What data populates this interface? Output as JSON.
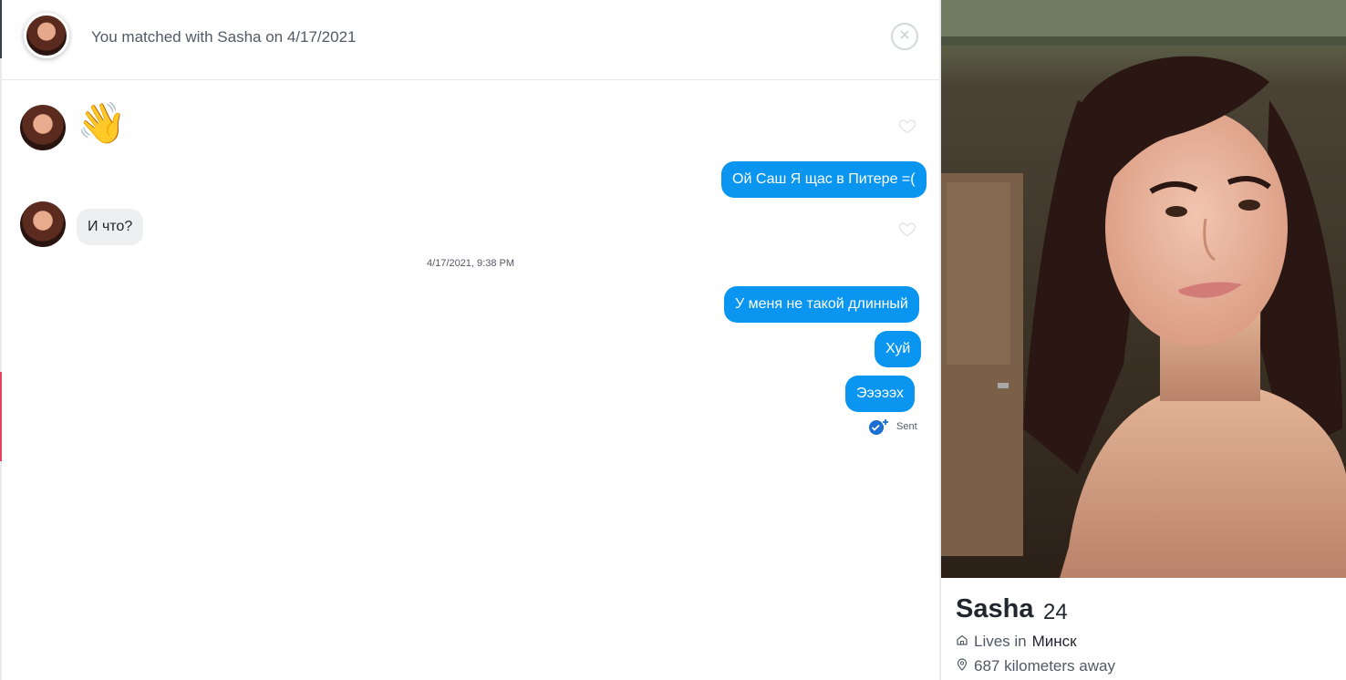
{
  "header": {
    "match_text": "You matched with Sasha on 4/17/2021",
    "close_icon": "close-icon"
  },
  "messages": [
    {
      "direction": "in",
      "text": "👋",
      "type": "emoji"
    },
    {
      "direction": "out",
      "text": "Ой Саш Я щас в Питере =("
    },
    {
      "direction": "in",
      "text": "И что?"
    },
    {
      "direction": "out",
      "text": "У меня не такой длинный"
    },
    {
      "direction": "out",
      "text": "Хуй"
    },
    {
      "direction": "out",
      "text": "Эээээх"
    }
  ],
  "timestamp": "4/17/2021, 9:38 PM",
  "status": {
    "label": "Sent",
    "icon": "sent-check-icon"
  },
  "profile": {
    "name": "Sasha",
    "age": "24",
    "lives_prefix": "Lives in",
    "city": "Минск",
    "distance": "687 kilometers away"
  },
  "colors": {
    "outgoing_bubble": "#0a96f0",
    "incoming_bubble": "#eeeff1",
    "accent_pink": "#e0475f"
  }
}
